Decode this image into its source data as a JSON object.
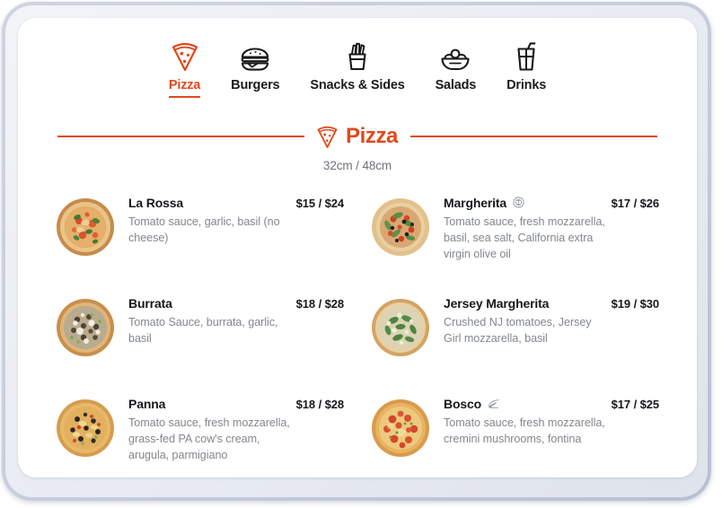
{
  "nav": {
    "tabs": [
      {
        "id": "pizza",
        "label": "Pizza",
        "icon": "pizza-slice-icon",
        "active": true
      },
      {
        "id": "burgers",
        "label": "Burgers",
        "icon": "burger-icon",
        "active": false
      },
      {
        "id": "snacks",
        "label": "Snacks & Sides",
        "icon": "fries-icon",
        "active": false
      },
      {
        "id": "salads",
        "label": "Salads",
        "icon": "salad-bowl-icon",
        "active": false
      },
      {
        "id": "drinks",
        "label": "Drinks",
        "icon": "drink-cup-icon",
        "active": false
      }
    ]
  },
  "section": {
    "title": "Pizza",
    "icon": "pizza-slice-icon",
    "subtitle": "32cm / 48cm",
    "accent_color": "#e2481c"
  },
  "menu": {
    "items": [
      {
        "name": "La Rossa",
        "price": "$15 / $24",
        "description": "Tomato sauce, garlic, basil (no cheese)",
        "badge": null,
        "thumb": "pizza-la-rossa"
      },
      {
        "name": "Margherita",
        "price": "$17 / $26",
        "description": "Tomato sauce, fresh mozzarella, basil, sea salt, California extra virgin olive oil",
        "badge": "award-medal-icon",
        "thumb": "pizza-margherita"
      },
      {
        "name": "Burrata",
        "price": "$18 / $28",
        "description": "Tomato Sauce, burrata, garlic, basil",
        "badge": null,
        "thumb": "pizza-burrata"
      },
      {
        "name": "Jersey Margherita",
        "price": "$19 / $30",
        "description": "Crushed NJ tomatoes, Jersey Girl mozzarella, basil",
        "badge": null,
        "thumb": "pizza-jersey-margherita"
      },
      {
        "name": "Panna",
        "price": "$18 / $28",
        "description": "Tomato sauce, fresh mozzarella, grass-fed PA cow's cream, arugula, parmigiano",
        "badge": null,
        "thumb": "pizza-panna"
      },
      {
        "name": "Bosco",
        "price": "$17 / $25",
        "description": "Tomato sauce, fresh mozzarella, cremini mushrooms, fontina",
        "badge": "leaf-icon",
        "thumb": "pizza-bosco"
      }
    ]
  }
}
